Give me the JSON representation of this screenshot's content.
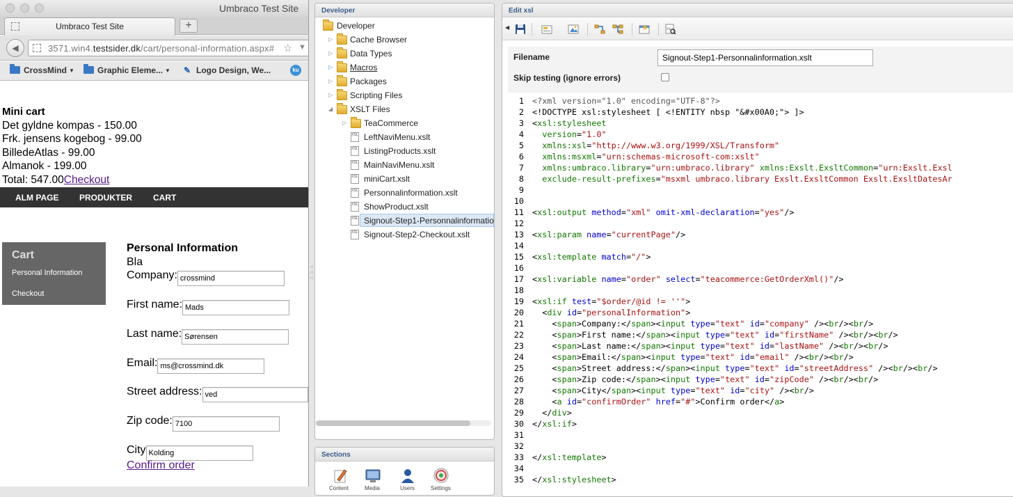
{
  "browser": {
    "window_title": "Umbraco Test Site",
    "tab_label": "Umbraco Test Site",
    "url_prefix": "3571.win4.",
    "url_domain": "testsider.dk",
    "url_path": "/cart/personal-information.aspx#",
    "bookmarks": [
      "CrossMind",
      "Graphic Eleme...",
      "Logo Design, We..."
    ],
    "bookmark_badge": "ku"
  },
  "site": {
    "mini_cart_title": "Mini cart",
    "items": [
      "Det gyldne kompas - 150.00",
      "Frk. jensens kogebog - 99.00",
      "BilledeAtlas - 99.00",
      "Almanok - 199.00"
    ],
    "total": "Total: 547.00",
    "checkout_link": "Checkout",
    "nav": [
      "ALM PAGE",
      "PRODUKTER",
      "CART"
    ],
    "cart_box_title": "Cart",
    "cart_links": [
      "Personal Information",
      "Checkout"
    ],
    "form_title": "Personal Information",
    "form_subtitle": "Bla",
    "fields": [
      {
        "label": "Company:",
        "value": "crossmind"
      },
      {
        "label": "First name:",
        "value": "Mads"
      },
      {
        "label": "Last name:",
        "value": "Sørensen"
      },
      {
        "label": "Email:",
        "value": "ms@crossmind.dk"
      },
      {
        "label": "Street address:",
        "value": "ved"
      },
      {
        "label": "Zip code:",
        "value": "7100"
      },
      {
        "label": "City",
        "value": "Kolding"
      }
    ],
    "confirm_link": "Confirm order"
  },
  "tree": {
    "panel_title": "Developer",
    "root": "Developer",
    "folders": [
      "Cache Browser",
      "Data Types",
      "Macros",
      "Packages",
      "Scripting Files",
      "XSLT Files"
    ],
    "xslt_subfolder": "TeaCommerce",
    "xslt_files": [
      "LeftNaviMenu.xslt",
      "ListingProducts.xslt",
      "MainNaviMenu.xslt",
      "miniCart.xslt",
      "Personnalinformation.xslt",
      "ShowProduct.xslt",
      "Signout-Step1-Personnalinformatio",
      "Signout-Step2-Checkout.xslt"
    ],
    "sections_title": "Sections",
    "section_labels": [
      "Content",
      "Media",
      "Users",
      "Settings"
    ]
  },
  "editor": {
    "panel_title": "Edit xsl",
    "filename_label": "Filename",
    "filename_value": "Signout-Step1-Personnalinformation.xslt",
    "skip_label": "Skip testing (ignore errors)",
    "code_lines": [
      [
        [
          "m",
          "<?xml version=\"1.0\" encoding=\"UTF-8\"?>"
        ]
      ],
      [
        [
          "p",
          "<!DOCTYPE xsl:stylesheet [ <!ENTITY nbsp \"&#x00A0;\"> ]>"
        ]
      ],
      [
        [
          "p",
          "<"
        ],
        [
          "t",
          "xsl:stylesheet"
        ]
      ],
      [
        [
          "p",
          "  "
        ],
        [
          "t",
          "version"
        ],
        [
          "p",
          "="
        ],
        [
          "s",
          "\"1.0\""
        ]
      ],
      [
        [
          "p",
          "  "
        ],
        [
          "t",
          "xmlns:xsl"
        ],
        [
          "p",
          "="
        ],
        [
          "s",
          "\"http://www.w3.org/1999/XSL/Transform\""
        ]
      ],
      [
        [
          "p",
          "  "
        ],
        [
          "t",
          "xmlns:msxml"
        ],
        [
          "p",
          "="
        ],
        [
          "s",
          "\"urn:schemas-microsoft-com:xslt\""
        ]
      ],
      [
        [
          "p",
          "  "
        ],
        [
          "t",
          "xmlns:umbraco.library"
        ],
        [
          "p",
          "="
        ],
        [
          "s",
          "\"urn:umbraco.library\""
        ],
        [
          "p",
          " "
        ],
        [
          "t",
          "xmlns:Exslt.ExsltCommon"
        ],
        [
          "p",
          "="
        ],
        [
          "s",
          "\"urn:Exslt.Exsl"
        ]
      ],
      [
        [
          "p",
          "  "
        ],
        [
          "t",
          "exclude-result-prefixes"
        ],
        [
          "p",
          "="
        ],
        [
          "s",
          "\"msxml umbraco.library Exslt.ExsltCommon Exslt.ExsltDatesAr"
        ]
      ],
      [],
      [],
      [
        [
          "p",
          "<"
        ],
        [
          "t",
          "xsl:output"
        ],
        [
          "p",
          " "
        ],
        [
          "a",
          "method"
        ],
        [
          "p",
          "="
        ],
        [
          "s",
          "\"xml\""
        ],
        [
          "p",
          " "
        ],
        [
          "a",
          "omit-xml-declaration"
        ],
        [
          "p",
          "="
        ],
        [
          "s",
          "\"yes\""
        ],
        [
          "p",
          "/>"
        ]
      ],
      [],
      [
        [
          "p",
          "<"
        ],
        [
          "t",
          "xsl:param"
        ],
        [
          "p",
          " "
        ],
        [
          "a",
          "name"
        ],
        [
          "p",
          "="
        ],
        [
          "s",
          "\"currentPage\""
        ],
        [
          "p",
          "/>"
        ]
      ],
      [],
      [
        [
          "p",
          "<"
        ],
        [
          "t",
          "xsl:template"
        ],
        [
          "p",
          " "
        ],
        [
          "a",
          "match"
        ],
        [
          "p",
          "="
        ],
        [
          "s",
          "\"/\""
        ],
        [
          "p",
          ">"
        ]
      ],
      [],
      [
        [
          "p",
          "<"
        ],
        [
          "t",
          "xsl:variable"
        ],
        [
          "p",
          " "
        ],
        [
          "a",
          "name"
        ],
        [
          "p",
          "="
        ],
        [
          "s",
          "\"order\""
        ],
        [
          "p",
          " "
        ],
        [
          "a",
          "select"
        ],
        [
          "p",
          "="
        ],
        [
          "s",
          "\"teacommerce:GetOrderXml()\""
        ],
        [
          "p",
          "/>"
        ]
      ],
      [],
      [
        [
          "p",
          "<"
        ],
        [
          "t",
          "xsl:if"
        ],
        [
          "p",
          " "
        ],
        [
          "a",
          "test"
        ],
        [
          "p",
          "="
        ],
        [
          "s",
          "\"$order/@id != ''\""
        ],
        [
          "p",
          ">"
        ]
      ],
      [
        [
          "p",
          "  <"
        ],
        [
          "t",
          "div"
        ],
        [
          "p",
          " "
        ],
        [
          "a",
          "id"
        ],
        [
          "p",
          "="
        ],
        [
          "s",
          "\"personalInformation\""
        ],
        [
          "p",
          ">"
        ]
      ],
      [
        [
          "p",
          "    <"
        ],
        [
          "t",
          "span"
        ],
        [
          "p",
          ">Company:</"
        ],
        [
          "t",
          "span"
        ],
        [
          "p",
          "><"
        ],
        [
          "t",
          "input"
        ],
        [
          "p",
          " "
        ],
        [
          "a",
          "type"
        ],
        [
          "p",
          "="
        ],
        [
          "s",
          "\"text\""
        ],
        [
          "p",
          " "
        ],
        [
          "a",
          "id"
        ],
        [
          "p",
          "="
        ],
        [
          "s",
          "\"company\""
        ],
        [
          "p",
          " /><"
        ],
        [
          "t",
          "br"
        ],
        [
          "p",
          "/><"
        ],
        [
          "t",
          "br"
        ],
        [
          "p",
          "/>"
        ]
      ],
      [
        [
          "p",
          "    <"
        ],
        [
          "t",
          "span"
        ],
        [
          "p",
          ">First name:</"
        ],
        [
          "t",
          "span"
        ],
        [
          "p",
          "><"
        ],
        [
          "t",
          "input"
        ],
        [
          "p",
          " "
        ],
        [
          "a",
          "type"
        ],
        [
          "p",
          "="
        ],
        [
          "s",
          "\"text\""
        ],
        [
          "p",
          " "
        ],
        [
          "a",
          "id"
        ],
        [
          "p",
          "="
        ],
        [
          "s",
          "\"firstName\""
        ],
        [
          "p",
          " /><"
        ],
        [
          "t",
          "br"
        ],
        [
          "p",
          "/><"
        ],
        [
          "t",
          "br"
        ],
        [
          "p",
          "/>"
        ]
      ],
      [
        [
          "p",
          "    <"
        ],
        [
          "t",
          "span"
        ],
        [
          "p",
          ">Last name:</"
        ],
        [
          "t",
          "span"
        ],
        [
          "p",
          "><"
        ],
        [
          "t",
          "input"
        ],
        [
          "p",
          " "
        ],
        [
          "a",
          "type"
        ],
        [
          "p",
          "="
        ],
        [
          "s",
          "\"text\""
        ],
        [
          "p",
          " "
        ],
        [
          "a",
          "id"
        ],
        [
          "p",
          "="
        ],
        [
          "s",
          "\"lastName\""
        ],
        [
          "p",
          " /><"
        ],
        [
          "t",
          "br"
        ],
        [
          "p",
          "/><"
        ],
        [
          "t",
          "br"
        ],
        [
          "p",
          "/>"
        ]
      ],
      [
        [
          "p",
          "    <"
        ],
        [
          "t",
          "span"
        ],
        [
          "p",
          ">Email:</"
        ],
        [
          "t",
          "span"
        ],
        [
          "p",
          "><"
        ],
        [
          "t",
          "input"
        ],
        [
          "p",
          " "
        ],
        [
          "a",
          "type"
        ],
        [
          "p",
          "="
        ],
        [
          "s",
          "\"text\""
        ],
        [
          "p",
          " "
        ],
        [
          "a",
          "id"
        ],
        [
          "p",
          "="
        ],
        [
          "s",
          "\"email\""
        ],
        [
          "p",
          " /><"
        ],
        [
          "t",
          "br"
        ],
        [
          "p",
          "/><"
        ],
        [
          "t",
          "br"
        ],
        [
          "p",
          "/>"
        ]
      ],
      [
        [
          "p",
          "    <"
        ],
        [
          "t",
          "span"
        ],
        [
          "p",
          ">Street address:</"
        ],
        [
          "t",
          "span"
        ],
        [
          "p",
          "><"
        ],
        [
          "t",
          "input"
        ],
        [
          "p",
          " "
        ],
        [
          "a",
          "type"
        ],
        [
          "p",
          "="
        ],
        [
          "s",
          "\"text\""
        ],
        [
          "p",
          " "
        ],
        [
          "a",
          "id"
        ],
        [
          "p",
          "="
        ],
        [
          "s",
          "\"streetAddress\""
        ],
        [
          "p",
          " /><"
        ],
        [
          "t",
          "br"
        ],
        [
          "p",
          "/><"
        ],
        [
          "t",
          "br"
        ],
        [
          "p",
          "/>"
        ]
      ],
      [
        [
          "p",
          "    <"
        ],
        [
          "t",
          "span"
        ],
        [
          "p",
          ">Zip code:</"
        ],
        [
          "t",
          "span"
        ],
        [
          "p",
          "><"
        ],
        [
          "t",
          "input"
        ],
        [
          "p",
          " "
        ],
        [
          "a",
          "type"
        ],
        [
          "p",
          "="
        ],
        [
          "s",
          "\"text\""
        ],
        [
          "p",
          " "
        ],
        [
          "a",
          "id"
        ],
        [
          "p",
          "="
        ],
        [
          "s",
          "\"zipCode\""
        ],
        [
          "p",
          " /><"
        ],
        [
          "t",
          "br"
        ],
        [
          "p",
          "/><"
        ],
        [
          "t",
          "br"
        ],
        [
          "p",
          "/>"
        ]
      ],
      [
        [
          "p",
          "    <"
        ],
        [
          "t",
          "span"
        ],
        [
          "p",
          ">City</"
        ],
        [
          "t",
          "span"
        ],
        [
          "p",
          "><"
        ],
        [
          "t",
          "input"
        ],
        [
          "p",
          " "
        ],
        [
          "a",
          "type"
        ],
        [
          "p",
          "="
        ],
        [
          "s",
          "\"text\""
        ],
        [
          "p",
          " "
        ],
        [
          "a",
          "id"
        ],
        [
          "p",
          "="
        ],
        [
          "s",
          "\"city\""
        ],
        [
          "p",
          " /><"
        ],
        [
          "t",
          "br"
        ],
        [
          "p",
          "/>"
        ]
      ],
      [
        [
          "p",
          "    <"
        ],
        [
          "t",
          "a"
        ],
        [
          "p",
          " "
        ],
        [
          "a",
          "id"
        ],
        [
          "p",
          "="
        ],
        [
          "s",
          "\"confirmOrder\""
        ],
        [
          "p",
          " "
        ],
        [
          "a",
          "href"
        ],
        [
          "p",
          "="
        ],
        [
          "s",
          "\"#\""
        ],
        [
          "p",
          ">Confirm order</"
        ],
        [
          "t",
          "a"
        ],
        [
          "p",
          ">"
        ]
      ],
      [
        [
          "p",
          "  </"
        ],
        [
          "t",
          "div"
        ],
        [
          "p",
          ">"
        ]
      ],
      [
        [
          "p",
          "</"
        ],
        [
          "t",
          "xsl:if"
        ],
        [
          "p",
          ">"
        ]
      ],
      [],
      [],
      [
        [
          "p",
          "</"
        ],
        [
          "t",
          "xsl:template"
        ],
        [
          "p",
          ">"
        ]
      ],
      [],
      [
        [
          "p",
          "</"
        ],
        [
          "t",
          "xsl:stylesheet"
        ],
        [
          "p",
          ">"
        ]
      ]
    ]
  },
  "colors": {
    "tag": "#117700",
    "attribute": "#0000cc",
    "string": "#aa1111",
    "nav_bar": "#333333",
    "cart_box": "#666666",
    "link": "#551a8b"
  }
}
